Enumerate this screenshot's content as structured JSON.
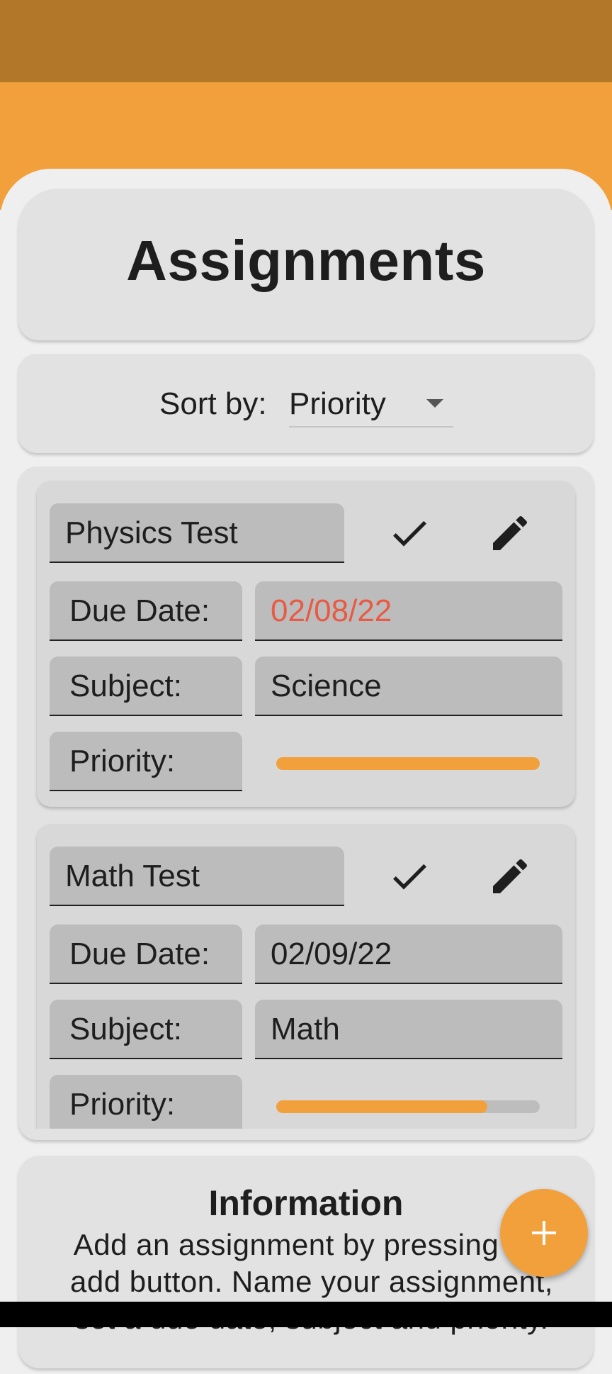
{
  "header": {
    "title": "Assignments"
  },
  "sort": {
    "label": "Sort by:",
    "value": "Priority"
  },
  "assignments": [
    {
      "name": "Physics Test",
      "due_label": "Due Date:",
      "due_date": "02/08/22",
      "due_overdue": true,
      "subject_label": "Subject:",
      "subject": "Science",
      "priority_label": "Priority:",
      "priority_fraction": 1.0
    },
    {
      "name": "Math Test",
      "due_label": "Due Date:",
      "due_date": "02/09/22",
      "due_overdue": false,
      "subject_label": "Subject:",
      "subject": "Math",
      "priority_label": "Priority:",
      "priority_fraction": 0.8
    }
  ],
  "info": {
    "title": "Information",
    "text": "Add an assignment by pressing the add button. Name your assignment, set a due date, subject and priority."
  },
  "icons": {
    "check": "check-icon",
    "edit": "pencil-icon",
    "add": "plus-icon",
    "dropdown": "chevron-down-icon"
  },
  "colors": {
    "accent": "#f2a03b",
    "status_bar": "#b3772a",
    "overdue": "#e85a44"
  }
}
